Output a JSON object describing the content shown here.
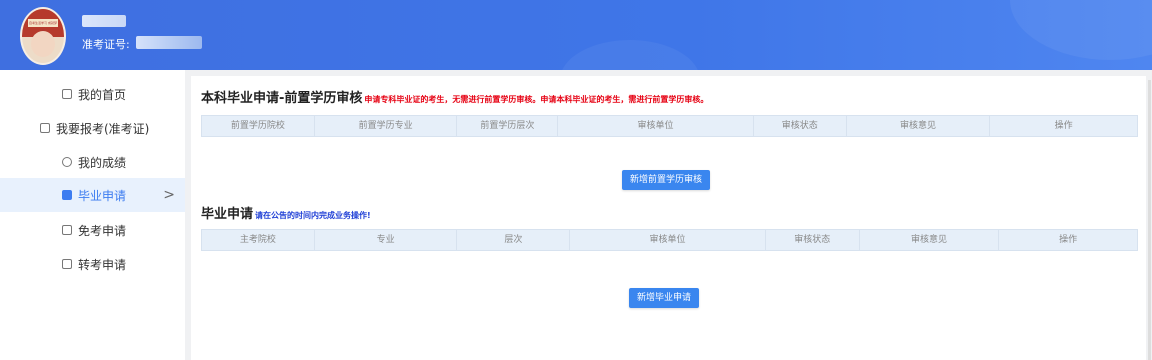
{
  "header": {
    "ticket_label": "准考证号:",
    "avatar_banner": "自考生活学习 成就梦想"
  },
  "sidebar": {
    "items": [
      {
        "label": "我的首页",
        "icon": "home-icon"
      },
      {
        "label": "我要报考(准考证)",
        "icon": "card-icon"
      },
      {
        "label": "我的成绩",
        "icon": "user-icon"
      },
      {
        "label": "毕业申请",
        "icon": "grad-icon",
        "active": true
      },
      {
        "label": "免考申请",
        "icon": "exempt-icon"
      },
      {
        "label": "转考申请",
        "icon": "transfer-icon"
      }
    ],
    "active_chevron": ">"
  },
  "section1": {
    "title": "本科毕业申请-前置学历审核",
    "note": "申请专科毕业证的考生，无需进行前置学历审核。申请本科毕业证的考生，需进行前置学历审核。",
    "columns": [
      "前置学历院校",
      "前置学历专业",
      "前置学历层次",
      "审核单位",
      "审核状态",
      "审核意见",
      "操作"
    ],
    "add_button": "新增前置学历审核"
  },
  "section2": {
    "title": "毕业申请",
    "note": "请在公告的时间内完成业务操作!",
    "columns": [
      "主考院校",
      "专业",
      "层次",
      "审核单位",
      "审核状态",
      "审核意见",
      "操作"
    ],
    "add_button": "新增毕业申请"
  },
  "colors": {
    "header": "#3f6fe0",
    "accent": "#3a86ef",
    "warning": "#e60012",
    "note_blue": "#1f3fd6"
  }
}
